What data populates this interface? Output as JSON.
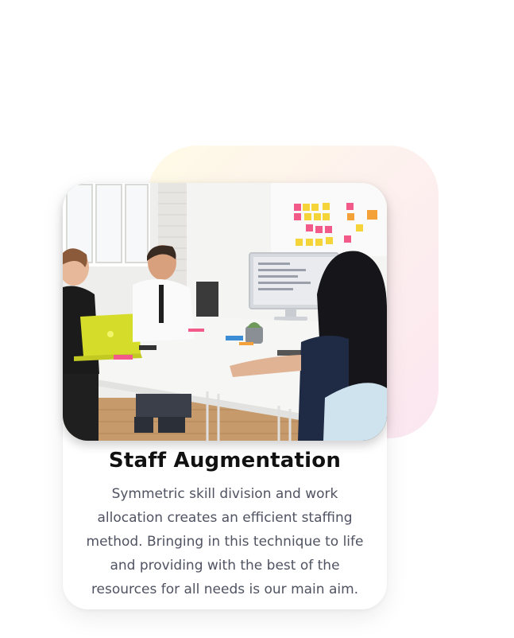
{
  "card": {
    "title": "Staff Augmentation",
    "description": "Symmetric skill division and work allocation creates an efficient staffing method. Bringing in this technique to life and providing with the best of the resources for all needs is our main aim."
  },
  "colors": {
    "blob_gradient": [
      "#fffbe6",
      "#fbe6f0"
    ],
    "title": "#111111",
    "body_text": "#505361",
    "card_background": "#ffffff"
  },
  "image": {
    "subject": "team-meeting-photo"
  }
}
